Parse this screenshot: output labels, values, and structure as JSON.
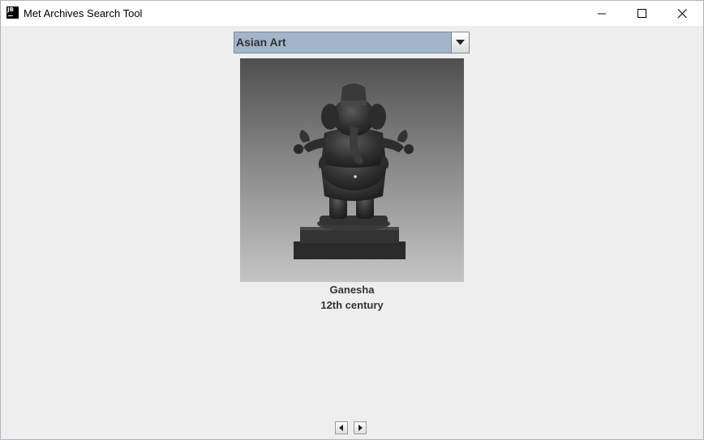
{
  "window": {
    "title": "Met Archives Search Tool",
    "app_icon_text": "JB"
  },
  "department_select": {
    "selected": "Asian Art"
  },
  "artwork": {
    "title": "Ganesha",
    "date": "12th century",
    "image_subject": "bronze statue of Ganesha on a rectangular pedestal"
  },
  "icons": {
    "minimize": "minimize-icon",
    "maximize": "maximize-icon",
    "close": "close-icon",
    "dropdown": "chevron-down-icon",
    "prev": "arrow-left-icon",
    "next": "arrow-right-icon"
  },
  "colors": {
    "combo_selection": "#a4b5ca",
    "window_bg": "#eeeeee",
    "caption_text": "#333333"
  }
}
